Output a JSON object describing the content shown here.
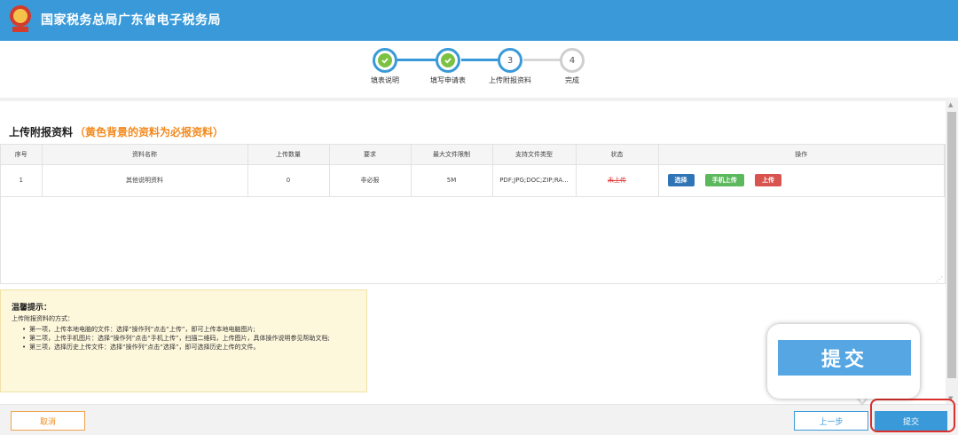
{
  "header": {
    "title": "国家税务总局广东省电子税务局",
    "logo_text": "税"
  },
  "steps": [
    {
      "label": "填表说明",
      "state": "done"
    },
    {
      "label": "填写申请表",
      "state": "done"
    },
    {
      "label": "上传附报资料",
      "state": "current",
      "number": "3"
    },
    {
      "label": "完成",
      "state": "todo",
      "number": "4"
    }
  ],
  "section": {
    "title": "上传附报资料",
    "note": "（黄色背景的资料为必报资料）"
  },
  "table": {
    "headers": [
      "序号",
      "资料名称",
      "上传数量",
      "要求",
      "最大文件限制",
      "支持文件类型",
      "状态",
      "操作"
    ],
    "rows": [
      {
        "index": "1",
        "name": "其他说明资料",
        "count": "0",
        "requirement": "非必报",
        "max_size": "5M",
        "file_types": "PDF;JPG;DOC;ZIP;RA...",
        "status": "未上传",
        "actions": {
          "select": "选择",
          "mobile": "手机上传",
          "upload": "上传"
        }
      }
    ]
  },
  "tips": {
    "title": "温馨提示：",
    "subtitle": "上传附报资料的方式：",
    "items": [
      "第一项，上传本地电脑的文件：选择“操作列”点击“上传”，即可上传本地电脑图片;",
      "第二项，上传手机图片：选择“操作列”点击“手机上传”，扫描二维码，上传图片，具体操作说明参见帮助文档;",
      "第三项，选择历史上传文件：选择“操作列”点击“选择”，即可选择历史上传的文件。"
    ]
  },
  "buttons": {
    "cancel": "取消",
    "prev": "上一步",
    "submit": "提交"
  },
  "callout": {
    "label": "提交"
  },
  "colors": {
    "primary": "#3a9ad9",
    "accent_orange": "#f28a1e",
    "success": "#7cc242",
    "danger": "#d9302c"
  }
}
